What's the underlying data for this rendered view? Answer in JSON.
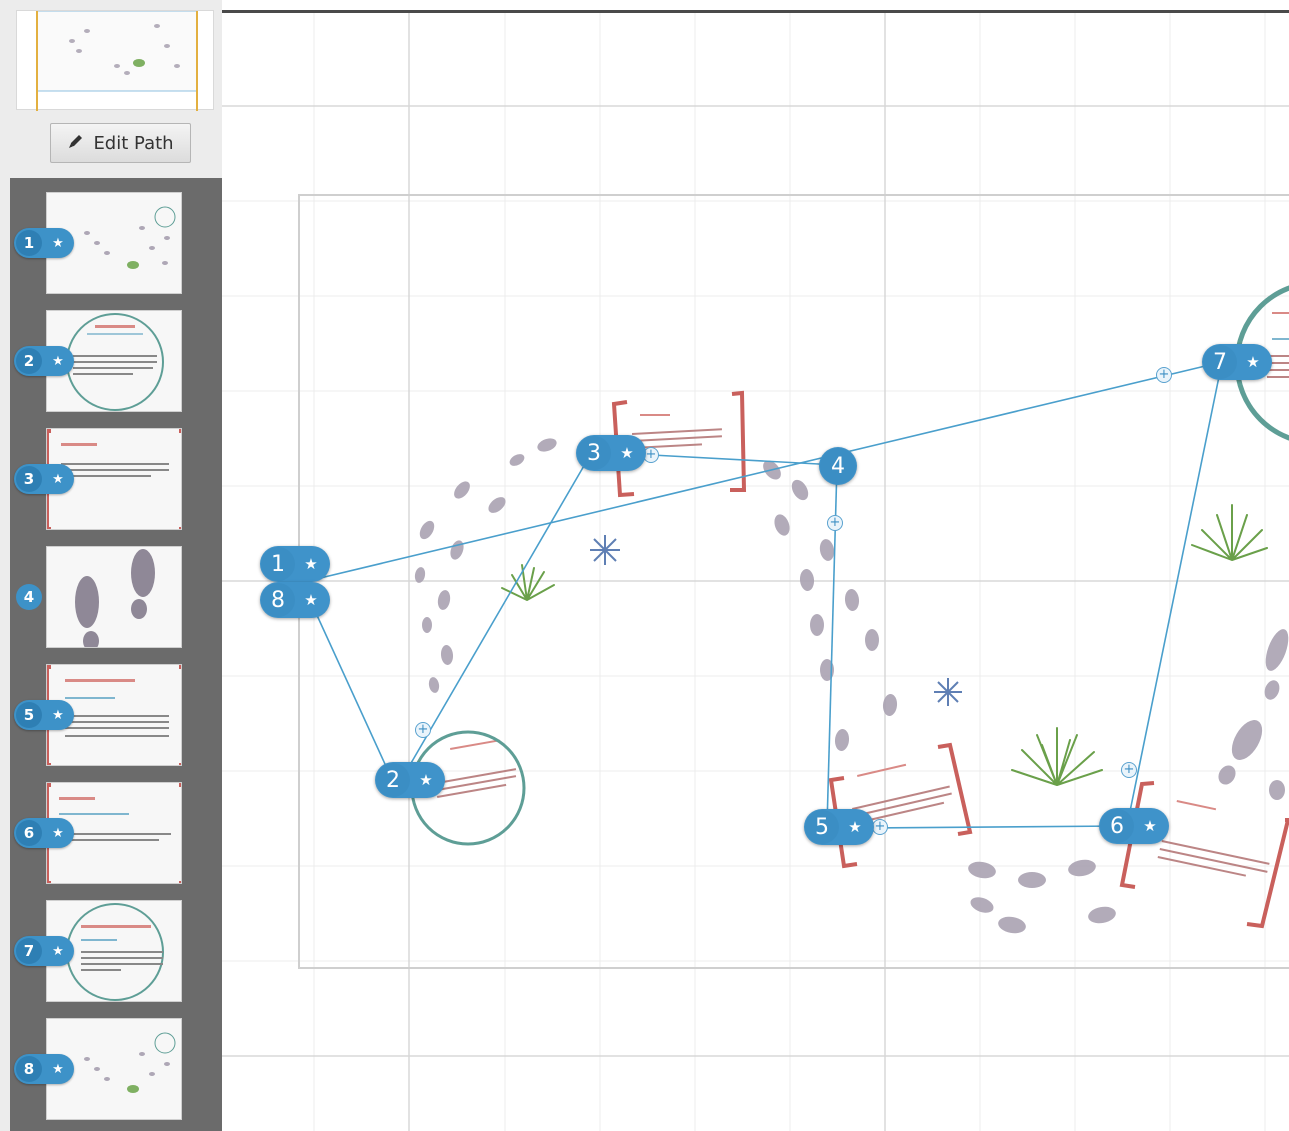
{
  "sidebar": {
    "edit_path_label": "Edit Path",
    "path_items": [
      {
        "number": "1",
        "has_zoom": true
      },
      {
        "number": "2",
        "has_zoom": true
      },
      {
        "number": "3",
        "has_zoom": true
      },
      {
        "number": "4",
        "has_zoom": false
      },
      {
        "number": "5",
        "has_zoom": true
      },
      {
        "number": "6",
        "has_zoom": true
      },
      {
        "number": "7",
        "has_zoom": true
      },
      {
        "number": "8",
        "has_zoom": true
      }
    ]
  },
  "canvas": {
    "nodes": [
      {
        "number": "1",
        "has_zoom": true
      },
      {
        "number": "8",
        "has_zoom": true
      },
      {
        "number": "2",
        "has_zoom": true
      },
      {
        "number": "3",
        "has_zoom": true
      },
      {
        "number": "4",
        "has_zoom": false
      },
      {
        "number": "5",
        "has_zoom": true
      },
      {
        "number": "6",
        "has_zoom": true
      },
      {
        "number": "7",
        "has_zoom": true
      }
    ]
  },
  "colors": {
    "path_line": "#4a9fcc",
    "node": "#3f93ca",
    "accent_red": "#c9605c",
    "accent_teal": "#5e9e96",
    "footprint": "#9f98a8",
    "plant": "#6aa04a"
  },
  "icons": {
    "edit": "pencil-icon",
    "zoom": "zoom-star-icon",
    "add": "plus-icon",
    "collapse": "collapse-handle-icon"
  }
}
